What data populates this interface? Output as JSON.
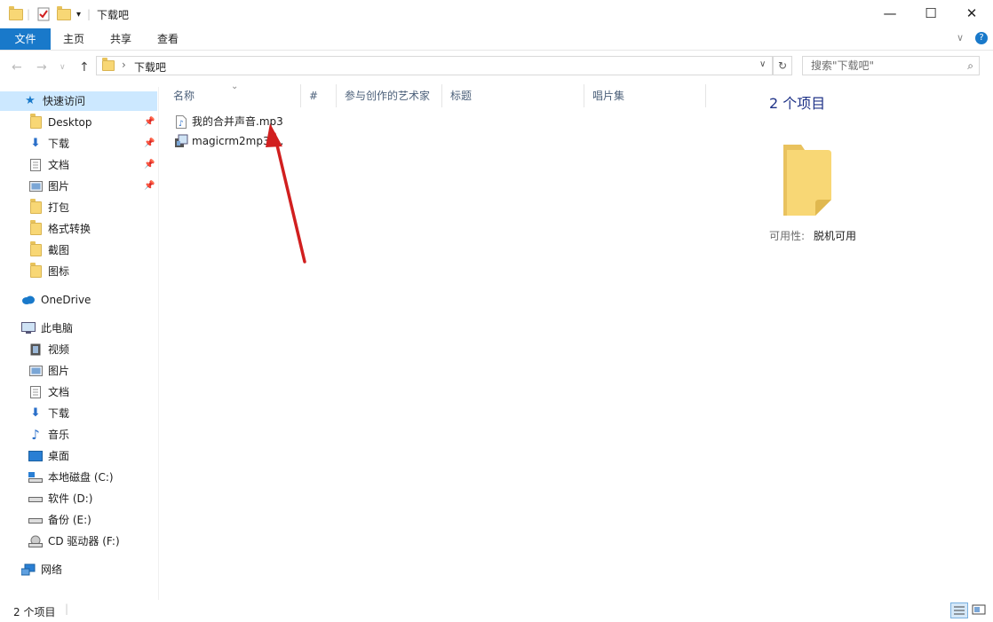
{
  "window": {
    "title": "下载吧",
    "controls": {
      "minimize": "—",
      "maximize": "☐",
      "close": "✕"
    }
  },
  "ribbon": {
    "tabs": [
      {
        "label": "文件",
        "active": true
      },
      {
        "label": "主页"
      },
      {
        "label": "共享"
      },
      {
        "label": "查看"
      }
    ]
  },
  "address": {
    "path_separator": "›",
    "path": "下载吧",
    "search_placeholder": "搜索\"下载吧\""
  },
  "nav": {
    "quick_access": "快速访问",
    "quick_items": [
      {
        "label": "Desktop",
        "icon": "folder-icon",
        "pinned": true
      },
      {
        "label": "下载",
        "icon": "download-icon",
        "pinned": true
      },
      {
        "label": "文档",
        "icon": "document-icon",
        "pinned": true
      },
      {
        "label": "图片",
        "icon": "picture-icon",
        "pinned": true
      },
      {
        "label": "打包",
        "icon": "folder-icon"
      },
      {
        "label": "格式转换",
        "icon": "folder-icon"
      },
      {
        "label": "截图",
        "icon": "folder-icon"
      },
      {
        "label": "图标",
        "icon": "folder-icon"
      }
    ],
    "onedrive": "OneDrive",
    "this_pc": "此电脑",
    "pc_items": [
      {
        "label": "视频",
        "icon": "video-icon"
      },
      {
        "label": "图片",
        "icon": "picture-icon"
      },
      {
        "label": "文档",
        "icon": "document-icon"
      },
      {
        "label": "下载",
        "icon": "download-icon"
      },
      {
        "label": "音乐",
        "icon": "music-icon"
      },
      {
        "label": "桌面",
        "icon": "desktop-icon"
      },
      {
        "label": "本地磁盘 (C:)",
        "icon": "system-drive-icon"
      },
      {
        "label": "软件 (D:)",
        "icon": "drive-icon"
      },
      {
        "label": "备份 (E:)",
        "icon": "drive-icon"
      },
      {
        "label": "CD 驱动器 (F:)",
        "icon": "cd-drive-icon"
      }
    ],
    "network": "网络"
  },
  "content": {
    "columns": [
      "名称",
      "#",
      "参与创作的艺术家",
      "标题",
      "唱片集"
    ],
    "files": [
      {
        "name": "我的合并声音.mp3",
        "icon": "audio-file-icon"
      },
      {
        "name": "magicrm2mp3-...",
        "icon": "app-file-icon"
      }
    ]
  },
  "preview": {
    "count": "2 个项目",
    "availability_label": "可用性:",
    "availability_value": "脱机可用"
  },
  "status": {
    "count": "2 个项目"
  },
  "colors": {
    "accent": "#1979ca",
    "selected": "#cce8ff",
    "folder": "#f8d775",
    "arrow": "#d11f1f"
  }
}
